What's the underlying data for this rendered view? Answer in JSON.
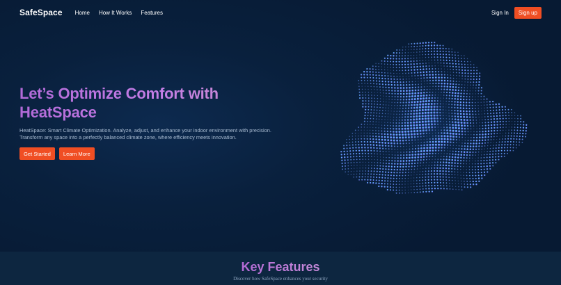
{
  "nav": {
    "brand": "SafeSpace",
    "links": [
      "Home",
      "How It Works",
      "Features"
    ],
    "sign_in": "Sign In",
    "sign_up": "Sign up"
  },
  "hero": {
    "headline_line1": "Let’s Optimize Comfort with",
    "headline_line2": "HeatSpace",
    "description_line1": "HeatSpace: Smart Climate Optimization. Analyze, adjust, and enhance your indoor environment with precision.",
    "description_line2": "Transform any space into a perfectly balanced climate zone, where efficiency meets innovation.",
    "get_started": "Get Started",
    "learn_more": "Learn More"
  },
  "features": {
    "title": "Key Features",
    "subtitle": "Discover how SafeSpace enhances your security"
  },
  "colors": {
    "accent": "#f04e23",
    "background": "#0a1a30",
    "headline_gradient_start": "#b26ad8",
    "orb_blue": "#5fb4ff",
    "orb_purple": "#a86bff"
  }
}
